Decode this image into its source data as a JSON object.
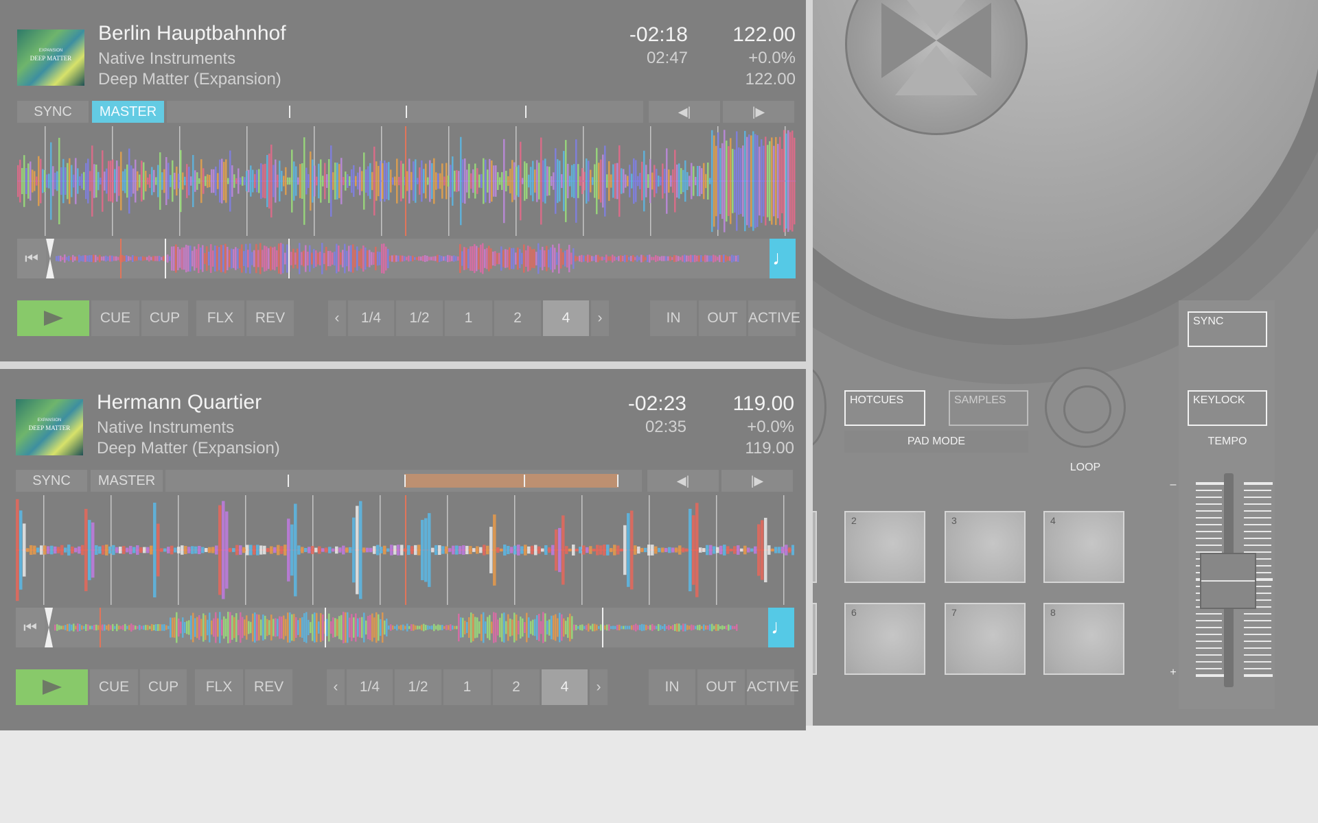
{
  "deck_a": {
    "title": "Berlin Hauptbahnhof",
    "artist": "Native Instruments",
    "album": "Deep Matter (Expansion)",
    "remaining": "-02:18",
    "elapsed": "02:47",
    "bpm": "122.00",
    "pitch": "+0.0%",
    "base_bpm": "122.00",
    "sync_label": "SYNC",
    "master_label": "MASTER",
    "master_active": true,
    "art_line1": "EXPANSION",
    "art_line2": "DEEP MATTER",
    "jump_back": "◀|",
    "jump_fwd": "|▶",
    "home_icon": "⏮",
    "cue_icon": "♩",
    "cue_label": "CUE",
    "cup_label": "CUP",
    "flx_label": "FLX",
    "rev_label": "REV",
    "prev_label": "‹",
    "next_label": "›",
    "loop_sizes": [
      "1/4",
      "1/2",
      "1",
      "2",
      "4"
    ],
    "loop_selected": "4",
    "in_label": "IN",
    "out_label": "OUT",
    "active_label": "ACTIVE"
  },
  "deck_b": {
    "title": "Hermann Quartier",
    "artist": "Native Instruments",
    "album": "Deep Matter (Expansion)",
    "remaining": "-02:23",
    "elapsed": "02:35",
    "bpm": "119.00",
    "pitch": "+0.0%",
    "base_bpm": "119.00",
    "sync_label": "SYNC",
    "master_label": "MASTER",
    "master_active": false,
    "art_line1": "EXPANSION",
    "art_line2": "DEEP MATTER",
    "jump_back": "◀|",
    "jump_fwd": "|▶",
    "home_icon": "⏮",
    "cue_icon": "♩",
    "cue_label": "CUE",
    "cup_label": "CUP",
    "flx_label": "FLX",
    "rev_label": "REV",
    "prev_label": "‹",
    "next_label": "›",
    "loop_sizes": [
      "1/4",
      "1/2",
      "1",
      "2",
      "4"
    ],
    "loop_selected": "4",
    "in_label": "IN",
    "out_label": "OUT",
    "active_label": "ACTIVE"
  },
  "hardware": {
    "hotcues": "HOTCUES",
    "samples": "SAMPLES",
    "pad_mode": "PAD MODE",
    "loop": "LOOP",
    "sync": "SYNC",
    "keylock": "KEYLOCK",
    "tempo": "TEMPO",
    "minus": "–",
    "plus": "+",
    "pads": [
      "2",
      "3",
      "4",
      "6",
      "7",
      "8"
    ]
  },
  "colors": {
    "panel": "#7f7f7f",
    "accent_blue": "#63cbe3",
    "play_green": "#88c96a",
    "loop_orange": "#c09070"
  }
}
